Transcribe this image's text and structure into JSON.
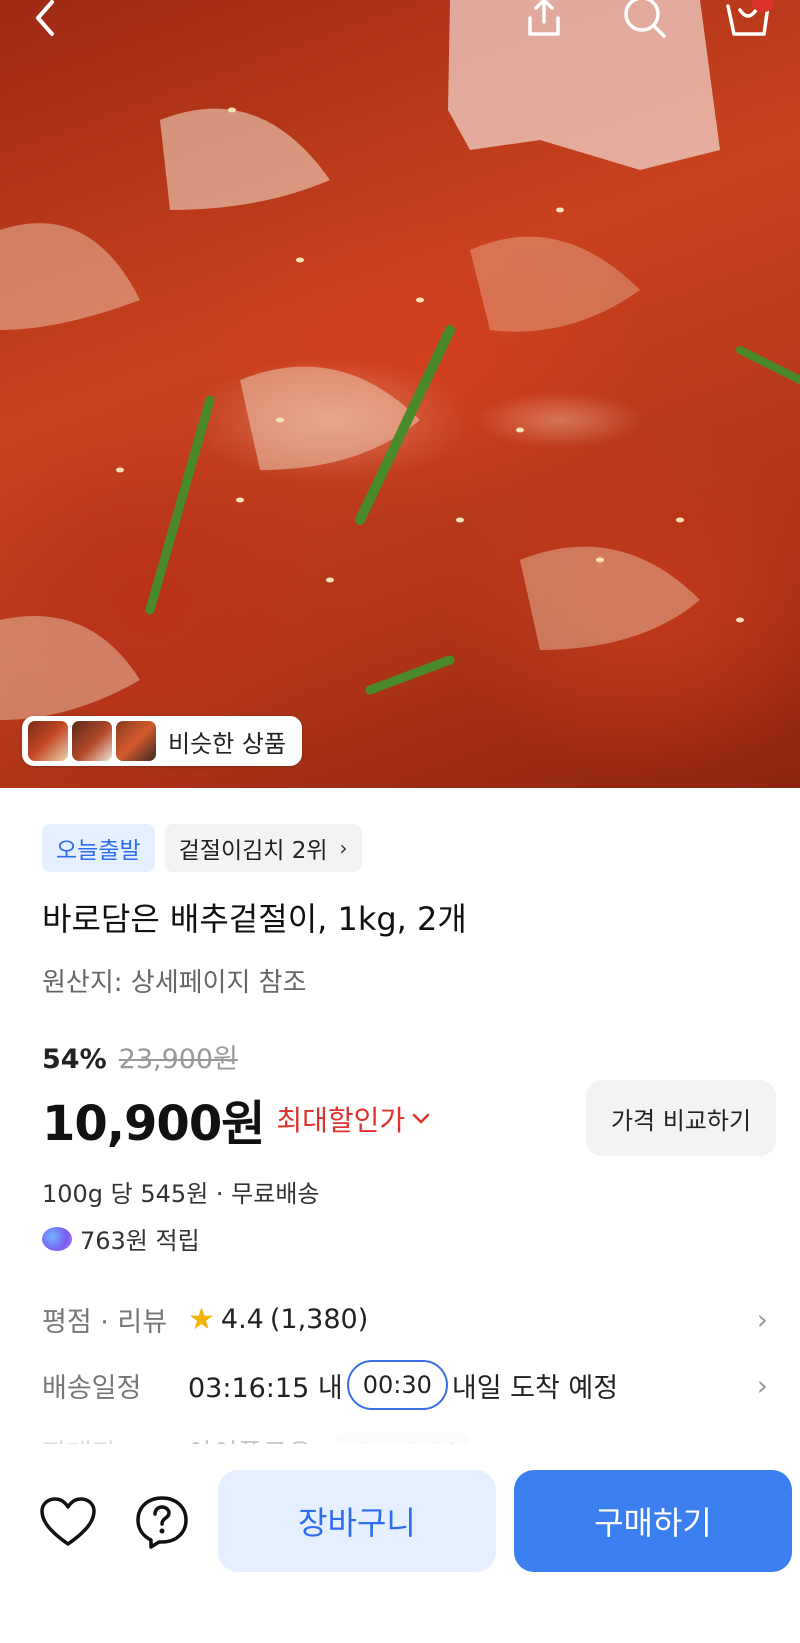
{
  "hero": {
    "similar_label": "비슷한 상품"
  },
  "top_nav": {
    "icons": [
      "back-icon",
      "share-icon",
      "search-icon",
      "cart-icon"
    ]
  },
  "product": {
    "tags": {
      "today_dispatch": "오늘출발",
      "ranking": "겉절이김치 2위"
    },
    "title": "바로담은 배추겉절이, 1kg, 2개",
    "origin": "원산지: 상세페이지 참조",
    "discount_percent": "54%",
    "original_price": "23,900원",
    "price": "10,900원",
    "max_discount_label": "최대할인가",
    "compare_label": "가격 비교하기",
    "unit_price": "100g 당 545원 · 무료배송",
    "points": "763원 적립"
  },
  "details": {
    "rating_label": "평점 · 리뷰",
    "rating_value": "4.4",
    "review_count": "(1,380)",
    "delivery_label": "배송일정",
    "delivery_time": "03:16:15 내",
    "delivery_timer": "00:30",
    "delivery_text": "내일 도착 예정",
    "seller_label": "판매자",
    "seller_name": "아이플로우",
    "seller_badge": "베스트판매자"
  },
  "bottom_bar": {
    "cart_label": "장바구니",
    "buy_label": "구매하기",
    "icons": [
      "heart-icon",
      "help-icon"
    ]
  },
  "colors": {
    "accent_blue": "#3b7ef0",
    "discount_red": "#e0322c",
    "tag_blue_bg": "#e6efff"
  }
}
